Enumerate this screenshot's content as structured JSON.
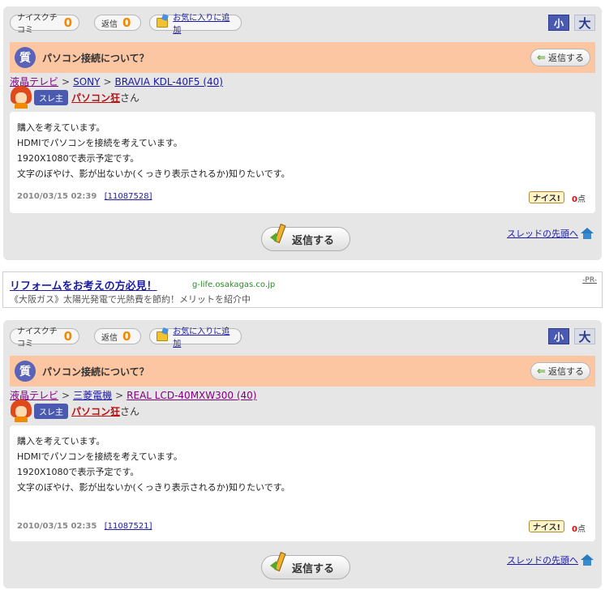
{
  "posts": [
    {
      "nice_label": "ナイスクチコミ",
      "nice_count": "0",
      "reply_label": "返信",
      "reply_count": "0",
      "fav_label": "お気に入りに追加",
      "size_small": "小",
      "size_large": "大",
      "q_icon": "質",
      "title": "パソコン接続について？",
      "small_reply": "返信する",
      "crumb1": "液晶テレビ",
      "crumb2": "SONY",
      "crumb3": "BRAVIA KDL-40F5 (40)",
      "sep": ">",
      "badge": "スレ主",
      "author": "パソコン狂",
      "suffix": "さん",
      "lines": [
        "購入を考えています。",
        "HDMIでパソコンを接続を考えています。",
        "1920X1080で表示予定です。",
        "文字のぼやけ、影が出ないか(くっきり表示されるか)知りたいです。"
      ],
      "date": "2010/03/15 02:39",
      "post_id": "[11087528]",
      "nice_button": "ナイス!",
      "points": "0",
      "points_unit": "点",
      "big_reply": "返信する",
      "thread_top": "スレッドの先頭へ"
    },
    {
      "nice_label": "ナイスクチコミ",
      "nice_count": "0",
      "reply_label": "返信",
      "reply_count": "0",
      "fav_label": "お気に入りに追加",
      "size_small": "小",
      "size_large": "大",
      "q_icon": "質",
      "title": "パソコン接続について？",
      "small_reply": "返信する",
      "crumb1": "液晶テレビ",
      "crumb2": "三菱電機",
      "crumb3": "REAL LCD-40MXW300 (40)",
      "sep": ">",
      "badge": "スレ主",
      "author": "パソコン狂",
      "suffix": "さん",
      "lines": [
        "購入を考えています。",
        "HDMIでパソコンを接続を考えています。",
        "1920X1080で表示予定です。",
        "文字のぼやけ、影が出ないか(くっきり表示されるか)知りたいです。"
      ],
      "date": "2010/03/15 02:35",
      "post_id": "[11087521]",
      "nice_button": "ナイス!",
      "points": "0",
      "points_unit": "点",
      "big_reply": "返信する",
      "thread_top": "スレッドの先頭へ"
    }
  ],
  "ad": {
    "headline": "リフォームをお考えの方必見！",
    "domain": "g-life.osakagas.co.jp",
    "pr": "-PR-",
    "text": "《大阪ガス》太陽光発電で光熱費を節約！メリットを紹介中"
  },
  "icons": {
    "folder": "favorite-folder-icon",
    "pencil": "pencil-reply-icon",
    "home": "home-arrow-icon"
  }
}
